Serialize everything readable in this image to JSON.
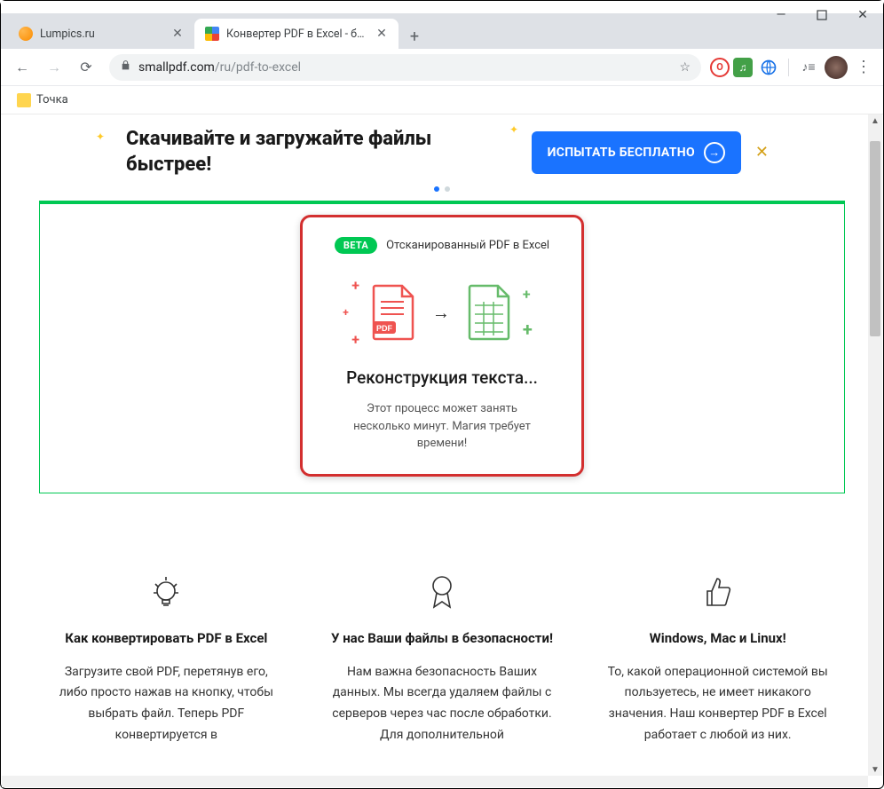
{
  "tabs": [
    {
      "title": "Lumpics.ru"
    },
    {
      "title": "Конвертер PDF в Excel - беспла"
    }
  ],
  "window": {
    "minimize": "—",
    "maximize": "□",
    "close": "✕"
  },
  "nav": {
    "back": "←",
    "forward": "→",
    "reload": "⟳"
  },
  "address": {
    "lock": "🔒",
    "domain": "smallpdf.com",
    "path": "/ru/pdf-to-excel",
    "star": "☆"
  },
  "extensions": {
    "opera": "O",
    "music": "♫",
    "globe": "⊕",
    "media": "♪≡",
    "menu": "⋮"
  },
  "bookmarks": [
    {
      "label": "Точка"
    }
  ],
  "promo": {
    "line1": "Скачивайте и загружайте файлы",
    "line2": "быстрее!",
    "cta": "ИСПЫТАТЬ БЕСПЛАТНО",
    "close": "✕"
  },
  "converter": {
    "beta": "BETA",
    "beta_text": "Отсканированный PDF в Excel",
    "pdf_badge": "PDF",
    "arrow": "→",
    "title": "Реконструкция текста...",
    "desc": "Этот процесс может занять несколько минут. Магия требует времени!"
  },
  "features": [
    {
      "title": "Как конвертировать PDF в Excel",
      "text": "Загрузите свой PDF, перетянув его, либо просто нажав на кнопку, чтобы выбрать файл. Теперь PDF конвертируется в"
    },
    {
      "title": "У нас Ваши файлы в безопасности!",
      "text": "Нам важна безопасность Ваших данных. Мы всегда удаляем файлы с серверов через час после обработки. Для дополнительной"
    },
    {
      "title": "Windows, Mac и Linux!",
      "text": "То, какой операционной системой вы пользуетесь, не имеет никакого значения. Наш конвертер PDF в Excel работает с любой из них."
    }
  ]
}
